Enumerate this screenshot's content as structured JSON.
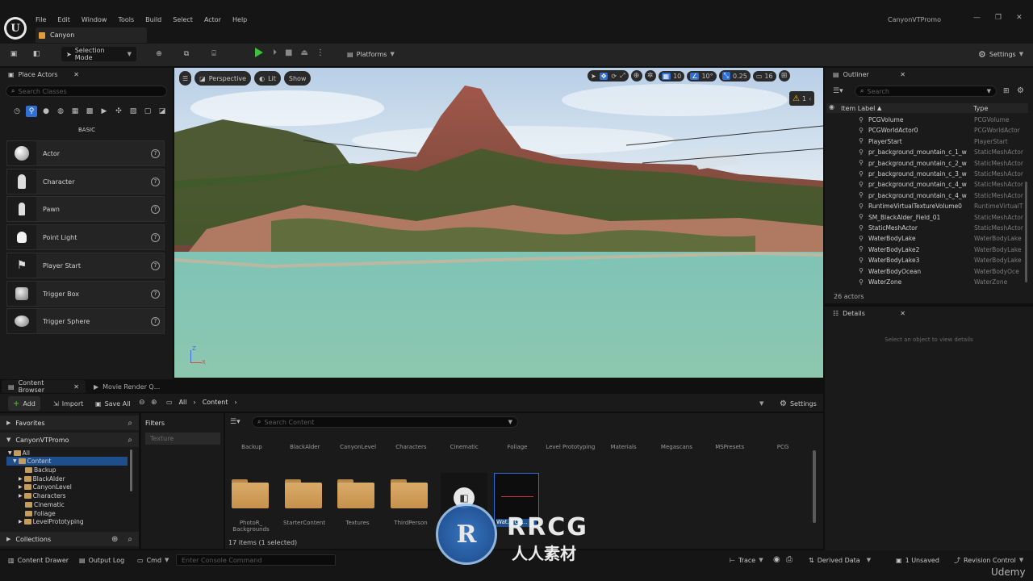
{
  "menu": [
    "File",
    "Edit",
    "Window",
    "Tools",
    "Build",
    "Select",
    "Actor",
    "Help"
  ],
  "project_name": "CanyonVTPromo",
  "level_tab": "Canyon",
  "toolbar": {
    "selection_mode": "Selection Mode",
    "platforms": "Platforms",
    "settings": "Settings"
  },
  "place_actors": {
    "tab": "Place Actors",
    "search_placeholder": "Search Classes",
    "category": "BASIC",
    "items": [
      "Actor",
      "Character",
      "Pawn",
      "Point Light",
      "Player Start",
      "Trigger Box",
      "Trigger Sphere"
    ]
  },
  "viewport": {
    "perspective": "Perspective",
    "lit": "Lit",
    "show": "Show",
    "grid": "10",
    "angle": "10°",
    "scale": "0.25",
    "camera_speed": "16",
    "warning_count": "1",
    "axis_z": "Z",
    "axis_x": "X"
  },
  "outliner": {
    "tab": "Outliner",
    "search_placeholder": "Search",
    "col_label": "Item Label",
    "col_type": "Type",
    "rows": [
      {
        "name": "PCGVolume",
        "type": "PCGVolume"
      },
      {
        "name": "PCGWorldActor0",
        "type": "PCGWorldActor"
      },
      {
        "name": "PlayerStart",
        "type": "PlayerStart"
      },
      {
        "name": "pr_background_mountain_c_1_w",
        "type": "StaticMeshActor"
      },
      {
        "name": "pr_background_mountain_c_2_w",
        "type": "StaticMeshActor"
      },
      {
        "name": "pr_background_mountain_c_3_w",
        "type": "StaticMeshActor"
      },
      {
        "name": "pr_background_mountain_c_4_w",
        "type": "StaticMeshActor"
      },
      {
        "name": "pr_background_mountain_c_4_w",
        "type": "StaticMeshActor"
      },
      {
        "name": "RuntimeVirtualTextureVolume0",
        "type": "RuntimeVirtualT"
      },
      {
        "name": "SM_BlackAlder_Field_01",
        "type": "StaticMeshActor"
      },
      {
        "name": "StaticMeshActor",
        "type": "StaticMeshActor"
      },
      {
        "name": "WaterBodyLake",
        "type": "WaterBodyLake"
      },
      {
        "name": "WaterBodyLake2",
        "type": "WaterBodyLake"
      },
      {
        "name": "WaterBodyLake3",
        "type": "WaterBodyLake"
      },
      {
        "name": "WaterBodyOcean",
        "type": "WaterBodyOce"
      },
      {
        "name": "WaterZone",
        "type": "WaterZone"
      }
    ],
    "count": "26 actors"
  },
  "details": {
    "tab": "Details",
    "empty": "Select an object to view details"
  },
  "content_browser": {
    "tab": "Content Browser",
    "tab2": "Movie Render Q...",
    "add": "Add",
    "import": "Import",
    "save_all": "Save All",
    "crumb_all": "All",
    "crumb_content": "Content",
    "settings": "Settings",
    "favorites": "Favorites",
    "project": "CanyonVTPromo",
    "filters": "Filters",
    "filter_texture": "Texture",
    "search_placeholder": "Search Content",
    "tree": [
      "All",
      "Content",
      "Backup",
      "BlackAlder",
      "CanyonLevel",
      "Characters",
      "Cinematic",
      "Foliage",
      "LevelPrototyping"
    ],
    "collections": "Collections",
    "top_labels": [
      "Backup",
      "BlackAlder",
      "CanyonLevel",
      "Characters",
      "Cinematic",
      "Foliage",
      "Level Prototyping",
      "Materials",
      "Megascans",
      "MSPresets",
      "PCG"
    ],
    "folders": [
      "PhotoR_ Backgrounds",
      "StarterContent",
      "Textures",
      "ThirdPerson"
    ],
    "asset_label": "Wat... Oc...",
    "status": "17 items (1 selected)"
  },
  "statusbar": {
    "content_drawer": "Content Drawer",
    "output_log": "Output Log",
    "cmd": "Cmd",
    "console_placeholder": "Enter Console Command",
    "trace": "Trace",
    "derived_data": "Derived Data",
    "unsaved": "1 Unsaved",
    "revision_control": "Revision Control"
  },
  "watermark": {
    "text": "RRCG",
    "sub": "人人素材",
    "udemy": "Udemy"
  }
}
